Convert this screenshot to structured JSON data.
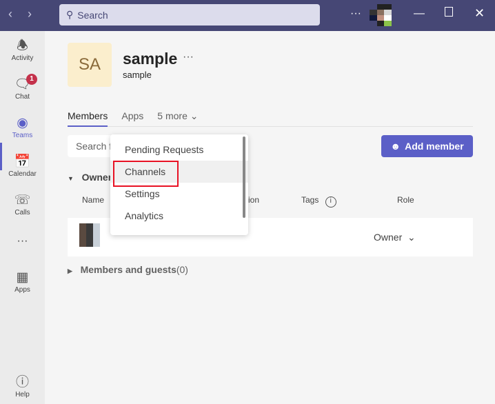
{
  "titlebar": {
    "search_placeholder": "Search",
    "more": "···",
    "icons": [
      "back-icon",
      "forward-icon",
      "search-icon",
      "more-icon",
      "minimize-icon",
      "maximize-icon",
      "close-icon"
    ]
  },
  "rail": {
    "items": [
      {
        "label": "Activity",
        "icon": "bell-icon"
      },
      {
        "label": "Chat",
        "icon": "chat-icon",
        "badge": "1"
      },
      {
        "label": "Teams",
        "icon": "teams-icon",
        "active": true
      },
      {
        "label": "Calendar",
        "icon": "calendar-icon"
      },
      {
        "label": "Calls",
        "icon": "phone-icon"
      },
      {
        "label": "···",
        "icon": "more-icon"
      },
      {
        "label": "Apps",
        "icon": "apps-icon"
      },
      {
        "label": "Help",
        "icon": "help-icon"
      }
    ]
  },
  "team": {
    "initials": "SA",
    "name": "sample",
    "more": "···",
    "description": "sample"
  },
  "tabs": [
    {
      "label": "Members",
      "active": true
    },
    {
      "label": "Apps"
    },
    {
      "label": "5 more ⌄"
    }
  ],
  "members": {
    "search_placeholder": "Search f",
    "add_member": "Add member",
    "owners_label": "Owner",
    "columns": {
      "name": "Name",
      "location": "ion",
      "tags": "Tags",
      "role": "Role"
    },
    "row": {
      "role": "Owner"
    },
    "guests_label": "Members and guests",
    "guests_count": "(0)"
  },
  "menu": {
    "items": [
      "Pending Requests",
      "Channels",
      "Settings",
      "Analytics"
    ],
    "highlighted": "Channels"
  },
  "colors": {
    "brand": "#464775",
    "accent": "#5b5fc7",
    "highlight_box": "#e81123"
  }
}
